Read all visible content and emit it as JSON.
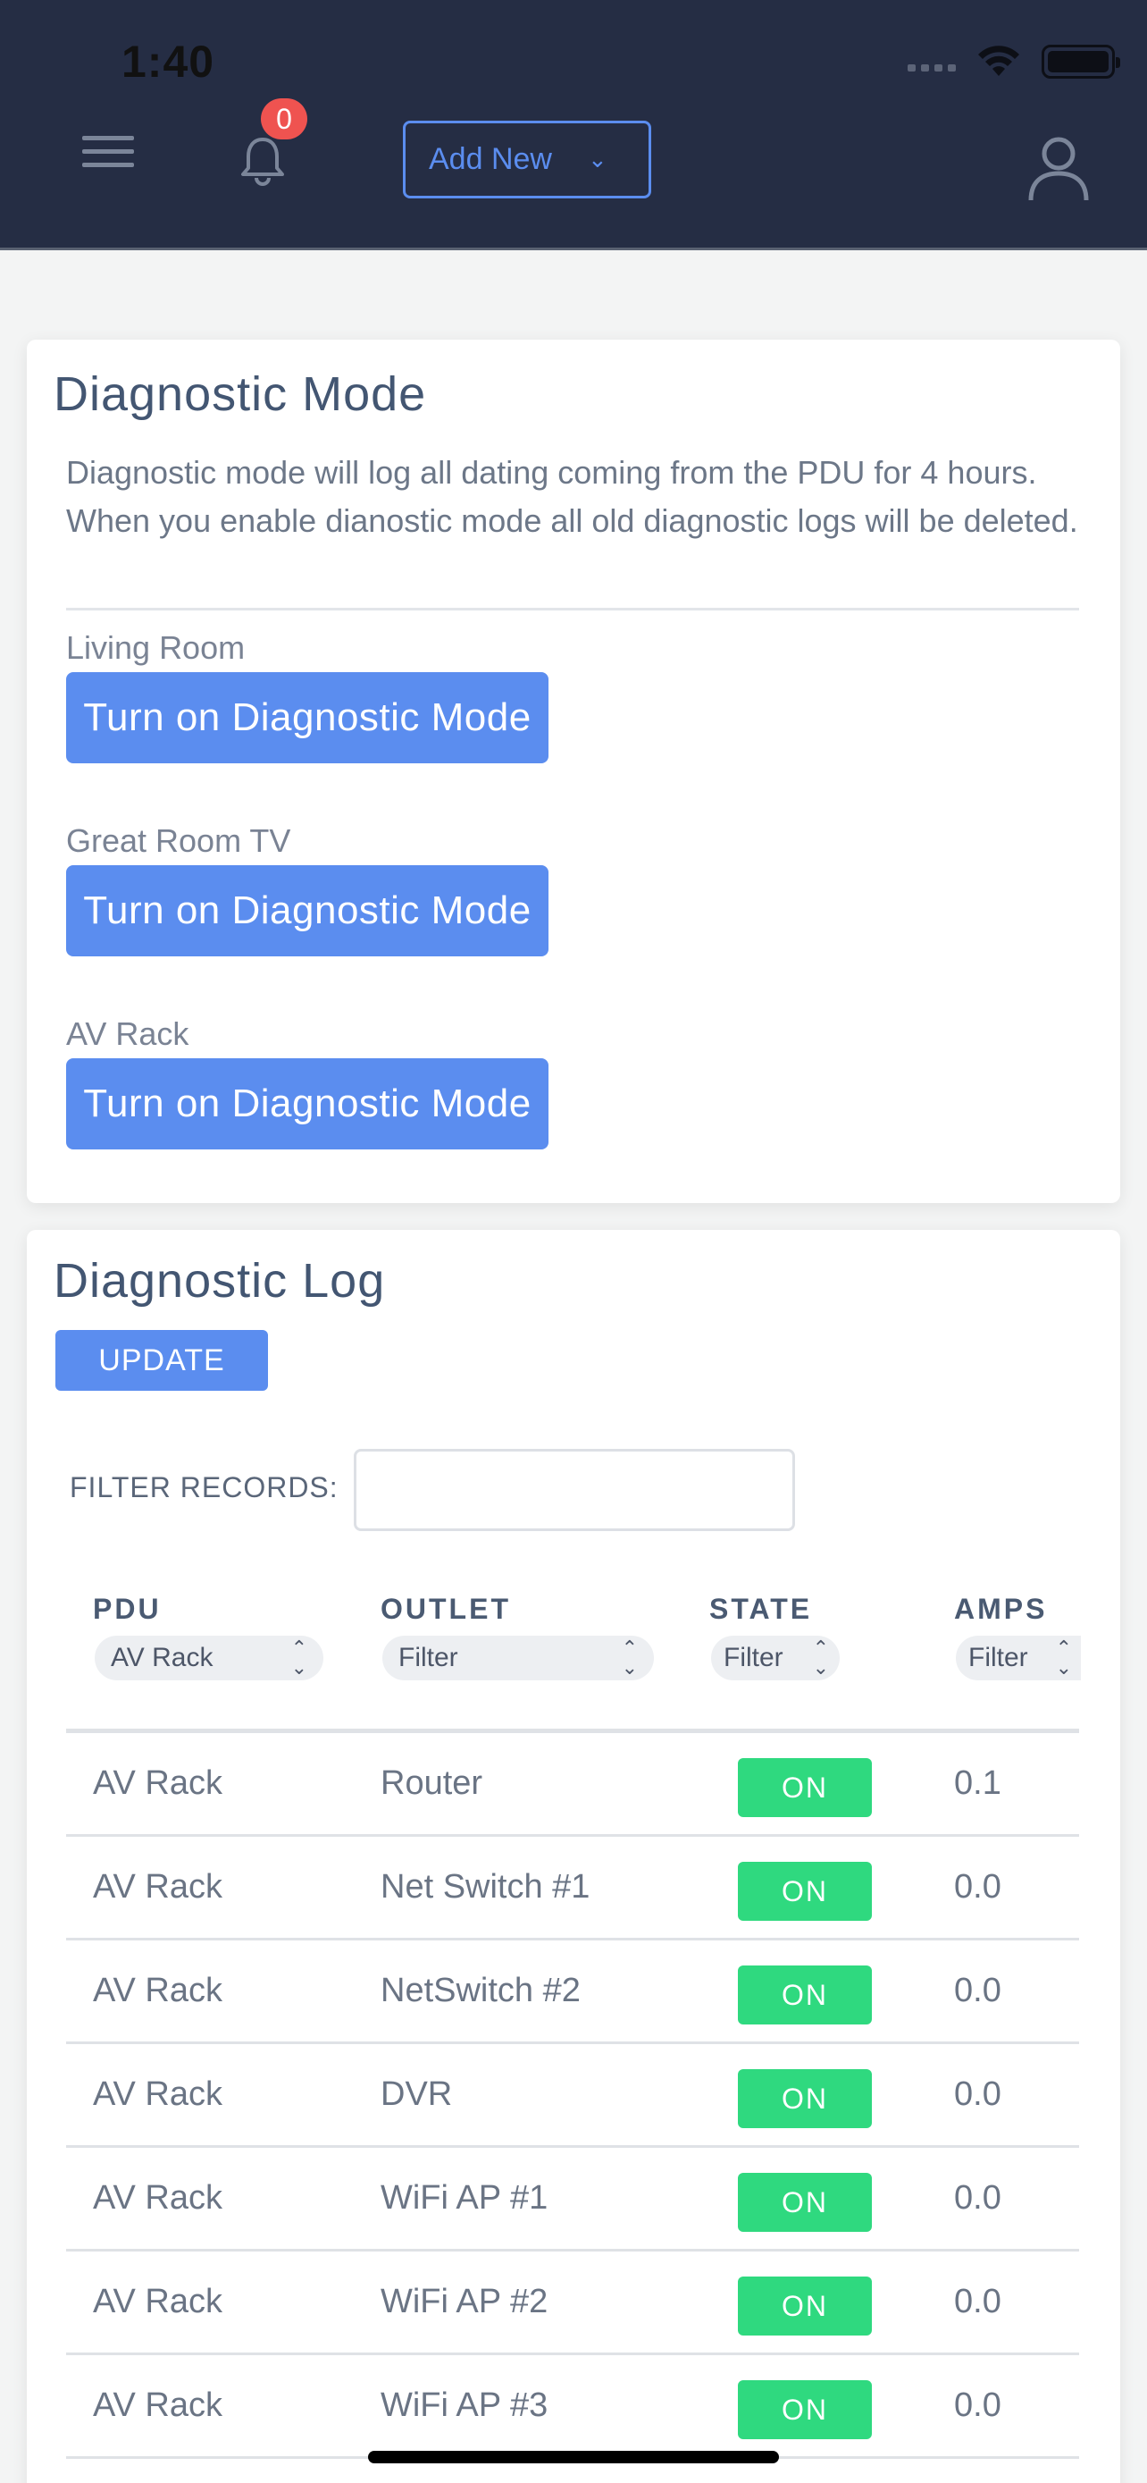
{
  "status_bar": {
    "time": "1:40"
  },
  "header": {
    "notification_count": "0",
    "add_new_label": "Add New"
  },
  "diagnostic_mode": {
    "title": "Diagnostic Mode",
    "description": "Diagnostic mode will log all dating coming from the PDU for 4 hours. When you enable dianostic mode all old diagnostic logs will be deleted.",
    "pdus": [
      {
        "name": "Living Room",
        "button_label": "Turn on Diagnostic Mode"
      },
      {
        "name": "Great Room TV",
        "button_label": "Turn on Diagnostic Mode"
      },
      {
        "name": "AV Rack",
        "button_label": "Turn on Diagnostic Mode"
      }
    ]
  },
  "diagnostic_log": {
    "title": "Diagnostic Log",
    "update_label": "UPDATE",
    "filter_label": "FILTER RECORDS:",
    "filter_value": "",
    "columns": [
      {
        "header": "PDU",
        "filter": "AV Rack"
      },
      {
        "header": "OUTLET",
        "filter": "Filter"
      },
      {
        "header": "STATE",
        "filter": "Filter"
      },
      {
        "header": "AMPS",
        "filter": "Filter"
      }
    ],
    "rows": [
      {
        "pdu": "AV Rack",
        "outlet": "Router",
        "state": "ON",
        "amps": "0.1"
      },
      {
        "pdu": "AV Rack",
        "outlet": "Net Switch #1",
        "state": "ON",
        "amps": "0.0"
      },
      {
        "pdu": "AV Rack",
        "outlet": "NetSwitch #2",
        "state": "ON",
        "amps": "0.0"
      },
      {
        "pdu": "AV Rack",
        "outlet": "DVR",
        "state": "ON",
        "amps": "0.0"
      },
      {
        "pdu": "AV Rack",
        "outlet": "WiFi AP #1",
        "state": "ON",
        "amps": "0.0"
      },
      {
        "pdu": "AV Rack",
        "outlet": "WiFi AP #2",
        "state": "ON",
        "amps": "0.0"
      },
      {
        "pdu": "AV Rack",
        "outlet": "WiFi AP #3",
        "state": "ON",
        "amps": "0.0"
      }
    ]
  },
  "colors": {
    "header_bg": "#252d44",
    "accent": "#5b8def",
    "on_state": "#2fd97f",
    "badge": "#ef5350"
  }
}
